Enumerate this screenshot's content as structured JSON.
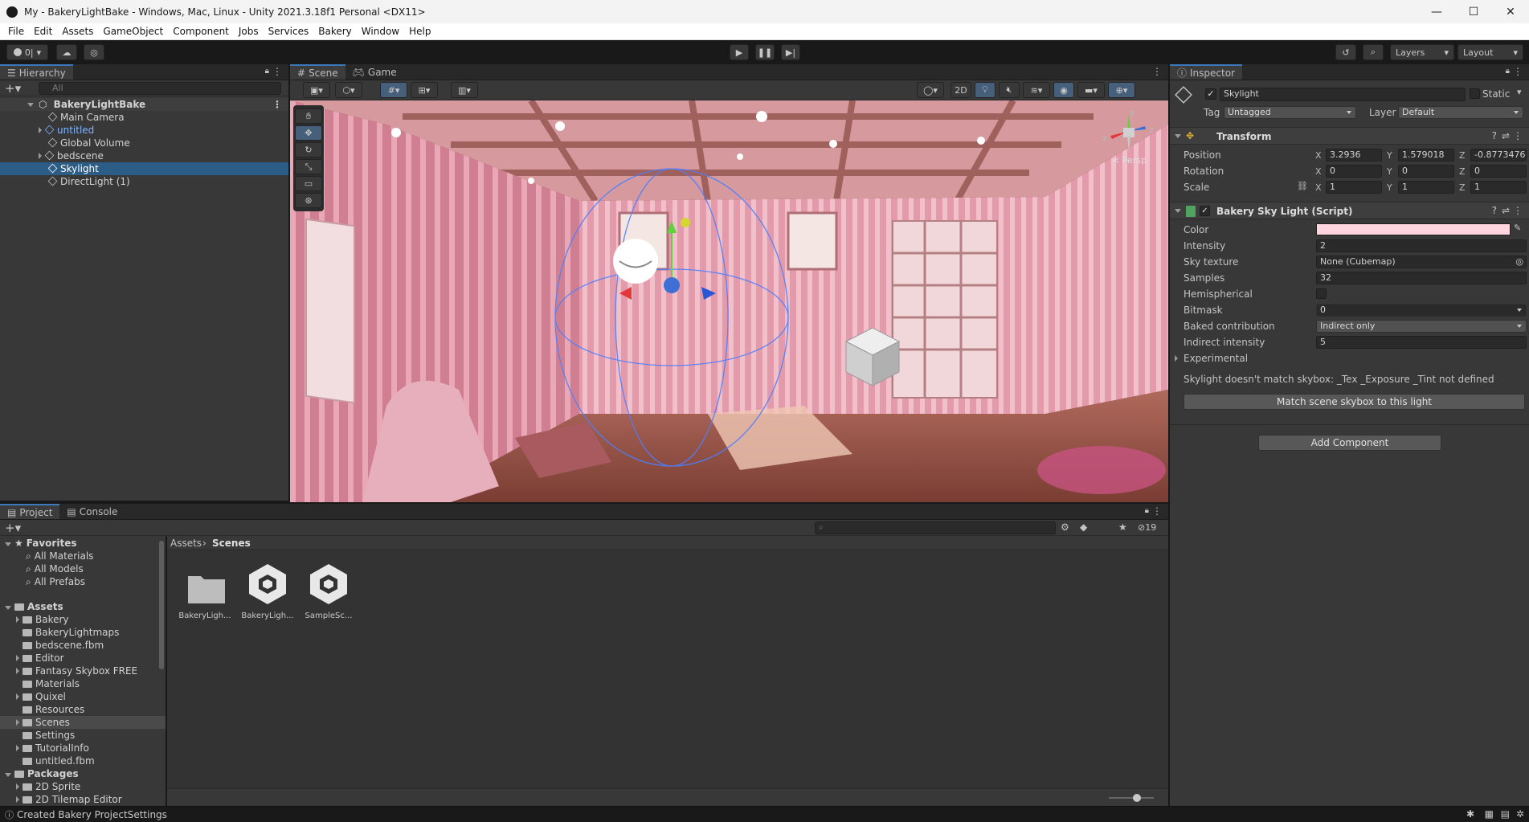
{
  "window": {
    "title": "My - BakeryLightBake - Windows, Mac, Linux - Unity 2021.3.18f1 Personal <DX11>",
    "controls": [
      "—",
      "☐",
      "✕"
    ]
  },
  "menu": [
    "File",
    "Edit",
    "Assets",
    "GameObject",
    "Component",
    "Jobs",
    "Services",
    "Bakery",
    "Window",
    "Help"
  ],
  "toolbar": {
    "account_label": "0|",
    "layers_label": "Layers",
    "layout_label": "Layout"
  },
  "hierarchy": {
    "tab_label": "Hierarchy",
    "search_placeholder": "All",
    "scene_name": "BakeryLightBake",
    "items": [
      {
        "label": "Main Camera"
      },
      {
        "label": "untitled"
      },
      {
        "label": "Global Volume"
      },
      {
        "label": "bedscene"
      },
      {
        "label": "Skylight"
      },
      {
        "label": "DirectLight (1)"
      }
    ]
  },
  "scene_view": {
    "tabs": [
      "Scene",
      "Game"
    ],
    "mode_2d_label": "2D",
    "persp_label": "< Persp",
    "gizmo_axes": {
      "x": "x",
      "y": "y",
      "z": "z"
    }
  },
  "inspector": {
    "tab_label": "Inspector",
    "object_name": "Skylight",
    "static_label": "Static",
    "tag_label": "Tag",
    "tag_value": "Untagged",
    "layer_label": "Layer",
    "layer_value": "Default",
    "transform": {
      "title": "Transform",
      "position_label": "Position",
      "rotation_label": "Rotation",
      "scale_label": "Scale",
      "position": {
        "x": "3.2936",
        "y": "1.579018",
        "z": "-0.8773476"
      },
      "rotation": {
        "x": "0",
        "y": "0",
        "z": "0"
      },
      "scale": {
        "x": "1",
        "y": "1",
        "z": "1"
      }
    },
    "component": {
      "title": "Bakery Sky Light (Script)",
      "fields": {
        "color_label": "Color",
        "color_value": "#ffd6e0",
        "intensity_label": "Intensity",
        "intensity_value": "2",
        "sky_texture_label": "Sky texture",
        "sky_texture_value": "None (Cubemap)",
        "samples_label": "Samples",
        "samples_value": "32",
        "hemispherical_label": "Hemispherical",
        "bitmask_label": "Bitmask",
        "bitmask_value": "0",
        "baked_contribution_label": "Baked contribution",
        "baked_contribution_value": "Indirect only",
        "indirect_intensity_label": "Indirect intensity",
        "indirect_intensity_value": "5",
        "experimental_label": "Experimental"
      },
      "warning": "Skylight doesn't match skybox: _Tex _Exposure _Tint not defined",
      "match_button": "Match scene skybox to this light"
    },
    "add_component_button": "Add Component"
  },
  "project": {
    "tabs": [
      "Project",
      "Console"
    ],
    "hidden_count": "19",
    "favorites_label": "Favorites",
    "favorites": [
      "All Materials",
      "All Models",
      "All Prefabs"
    ],
    "assets_label": "Assets",
    "assets": [
      "Bakery",
      "BakeryLightmaps",
      "bedscene.fbm",
      "Editor",
      "Fantasy Skybox FREE",
      "Materials",
      "Quixel",
      "Resources",
      "Scenes",
      "Settings",
      "TutorialInfo",
      "untitled.fbm"
    ],
    "packages_label": "Packages",
    "packages": [
      "2D Sprite",
      "2D Tilemap Editor"
    ],
    "breadcrumb": [
      "Assets",
      "Scenes"
    ],
    "grid_items": [
      {
        "label": "BakeryLigh...",
        "kind": "folder"
      },
      {
        "label": "BakeryLigh...",
        "kind": "unity-scene"
      },
      {
        "label": "SampleSc...",
        "kind": "unity-scene"
      }
    ]
  },
  "status": {
    "message": "Created Bakery ProjectSettings"
  },
  "colors": {
    "selection": "#2c5d87",
    "accent": "#3a79bb",
    "panel": "#383838"
  }
}
